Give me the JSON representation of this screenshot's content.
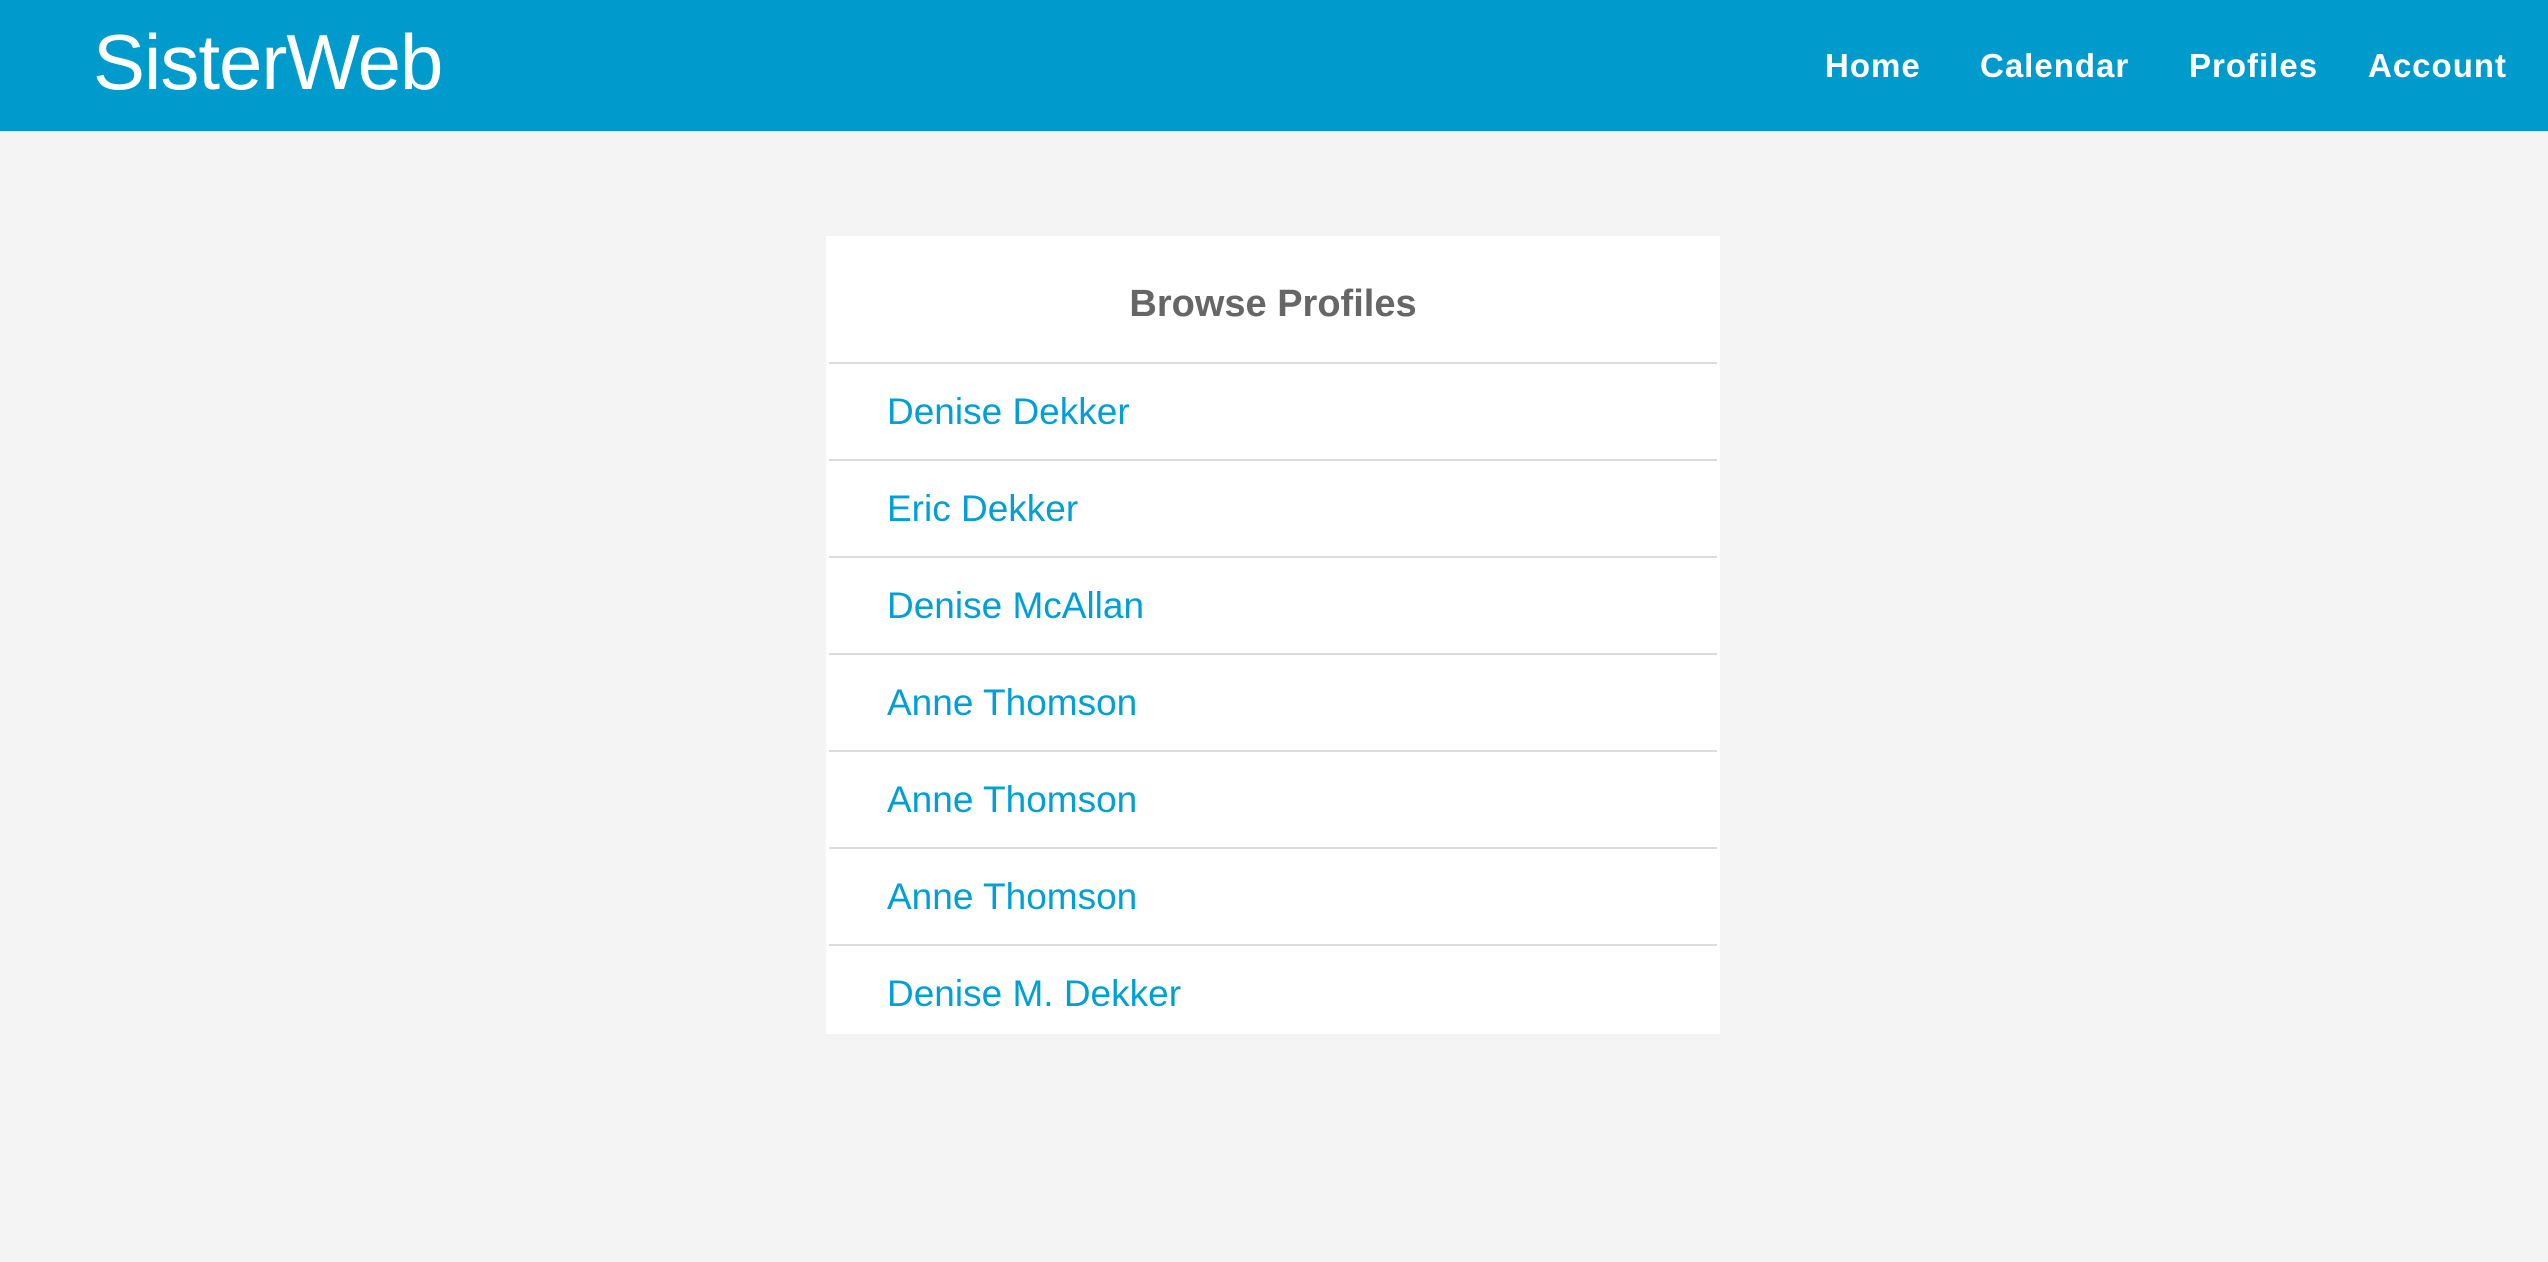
{
  "header": {
    "brand": "SisterWeb",
    "nav": [
      "Home",
      "Calendar",
      "Profiles",
      "Account"
    ]
  },
  "panel": {
    "title": "Browse Profiles",
    "profiles": [
      "Denise Dekker",
      "Eric Dekker",
      "Denise McAllan",
      "Anne Thomson",
      "Anne Thomson",
      "Anne Thomson",
      "Denise M. Dekker"
    ]
  },
  "colors": {
    "header_bg": "#009bcd",
    "link": "#009fd6",
    "page_bg": "#f4f4f4",
    "title_text": "#666666"
  }
}
